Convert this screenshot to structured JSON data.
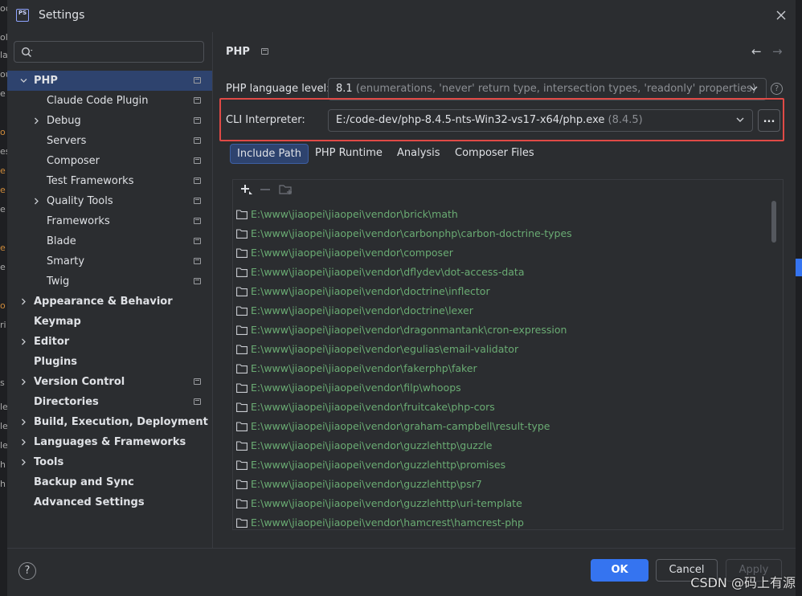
{
  "window": {
    "title": "Settings",
    "logo_text": "PS"
  },
  "search": {
    "placeholder": ""
  },
  "sidebar": {
    "items": [
      {
        "label": "PHP",
        "bold": true,
        "expanded": true,
        "selected": true,
        "project": true,
        "indent": 0
      },
      {
        "label": "Claude Code Plugin",
        "bold": false,
        "project": true,
        "indent": 1
      },
      {
        "label": "Debug",
        "bold": false,
        "collapsed": true,
        "project": true,
        "indent": 1
      },
      {
        "label": "Servers",
        "bold": false,
        "project": true,
        "indent": 1
      },
      {
        "label": "Composer",
        "bold": false,
        "project": true,
        "indent": 1
      },
      {
        "label": "Test Frameworks",
        "bold": false,
        "project": true,
        "indent": 1
      },
      {
        "label": "Quality Tools",
        "bold": false,
        "collapsed": true,
        "project": true,
        "indent": 1
      },
      {
        "label": "Frameworks",
        "bold": false,
        "project": true,
        "indent": 1
      },
      {
        "label": "Blade",
        "bold": false,
        "project": true,
        "indent": 1
      },
      {
        "label": "Smarty",
        "bold": false,
        "project": true,
        "indent": 1
      },
      {
        "label": "Twig",
        "bold": false,
        "project": true,
        "indent": 1
      },
      {
        "label": "Appearance & Behavior",
        "bold": true,
        "collapsed": true,
        "indent": 0
      },
      {
        "label": "Keymap",
        "bold": true,
        "indent": 0
      },
      {
        "label": "Editor",
        "bold": true,
        "collapsed": true,
        "indent": 0
      },
      {
        "label": "Plugins",
        "bold": true,
        "indent": 0
      },
      {
        "label": "Version Control",
        "bold": true,
        "collapsed": true,
        "project": true,
        "indent": 0
      },
      {
        "label": "Directories",
        "bold": true,
        "project": true,
        "indent": 0
      },
      {
        "label": "Build, Execution, Deployment",
        "bold": true,
        "collapsed": true,
        "indent": 0
      },
      {
        "label": "Languages & Frameworks",
        "bold": true,
        "collapsed": true,
        "indent": 0
      },
      {
        "label": "Tools",
        "bold": true,
        "collapsed": true,
        "indent": 0
      },
      {
        "label": "Backup and Sync",
        "bold": true,
        "indent": 0
      },
      {
        "label": "Advanced Settings",
        "bold": true,
        "indent": 0
      }
    ]
  },
  "header": {
    "breadcrumb": "PHP",
    "back": "←",
    "forward": "→"
  },
  "language_level": {
    "label": "PHP language level:",
    "value": "8.1",
    "hint": "(enumerations, 'never' return type, intersection types, 'readonly' properties)"
  },
  "cli": {
    "label": "CLI Interpreter:",
    "value": "E:/code-dev/php-8.4.5-nts-Win32-vs17-x64/php.exe",
    "hint": "(8.4.5)",
    "browse_label": "..."
  },
  "help_glyph": "?",
  "tabs": [
    {
      "label": "Include Path",
      "active": true
    },
    {
      "label": "PHP Runtime",
      "active": false
    },
    {
      "label": "Analysis",
      "active": false
    },
    {
      "label": "Composer Files",
      "active": false
    }
  ],
  "include_paths": [
    "E:\\www\\jiaopei\\jiaopei\\vendor\\brick\\math",
    "E:\\www\\jiaopei\\jiaopei\\vendor\\carbonphp\\carbon-doctrine-types",
    "E:\\www\\jiaopei\\jiaopei\\vendor\\composer",
    "E:\\www\\jiaopei\\jiaopei\\vendor\\dflydev\\dot-access-data",
    "E:\\www\\jiaopei\\jiaopei\\vendor\\doctrine\\inflector",
    "E:\\www\\jiaopei\\jiaopei\\vendor\\doctrine\\lexer",
    "E:\\www\\jiaopei\\jiaopei\\vendor\\dragonmantank\\cron-expression",
    "E:\\www\\jiaopei\\jiaopei\\vendor\\egulias\\email-validator",
    "E:\\www\\jiaopei\\jiaopei\\vendor\\fakerphp\\faker",
    "E:\\www\\jiaopei\\jiaopei\\vendor\\filp\\whoops",
    "E:\\www\\jiaopei\\jiaopei\\vendor\\fruitcake\\php-cors",
    "E:\\www\\jiaopei\\jiaopei\\vendor\\graham-campbell\\result-type",
    "E:\\www\\jiaopei\\jiaopei\\vendor\\guzzlehttp\\guzzle",
    "E:\\www\\jiaopei\\jiaopei\\vendor\\guzzlehttp\\promises",
    "E:\\www\\jiaopei\\jiaopei\\vendor\\guzzlehttp\\psr7",
    "E:\\www\\jiaopei\\jiaopei\\vendor\\guzzlehttp\\uri-template",
    "E:\\www\\jiaopei\\jiaopei\\vendor\\hamcrest\\hamcrest-php"
  ],
  "footer": {
    "ok": "OK",
    "cancel": "Cancel",
    "apply": "Apply",
    "help": "?"
  },
  "watermark": "CSDN @码上有源",
  "colors": {
    "accent": "#3574f0",
    "selection": "#2e436e",
    "path_text": "#6aab73",
    "highlight_box": "#e04a46"
  }
}
